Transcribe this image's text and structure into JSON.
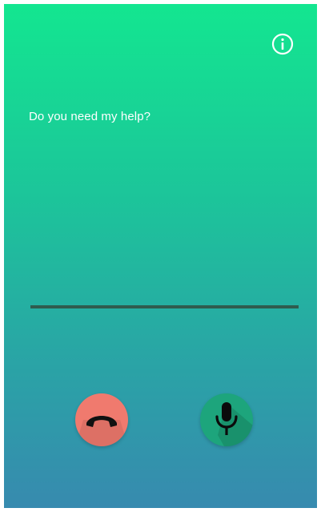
{
  "screen": {
    "prompt": "Do you need my help?"
  },
  "icons": {
    "info": "info-icon",
    "hangup": "phone-hangup-icon",
    "mic": "microphone-icon"
  },
  "colors": {
    "gradient_top": "#13e690",
    "gradient_bottom": "#378aaf",
    "hangup_button": "#f07a6e",
    "mic_button": "#1da57c",
    "input_line": "#2f5c4f"
  }
}
